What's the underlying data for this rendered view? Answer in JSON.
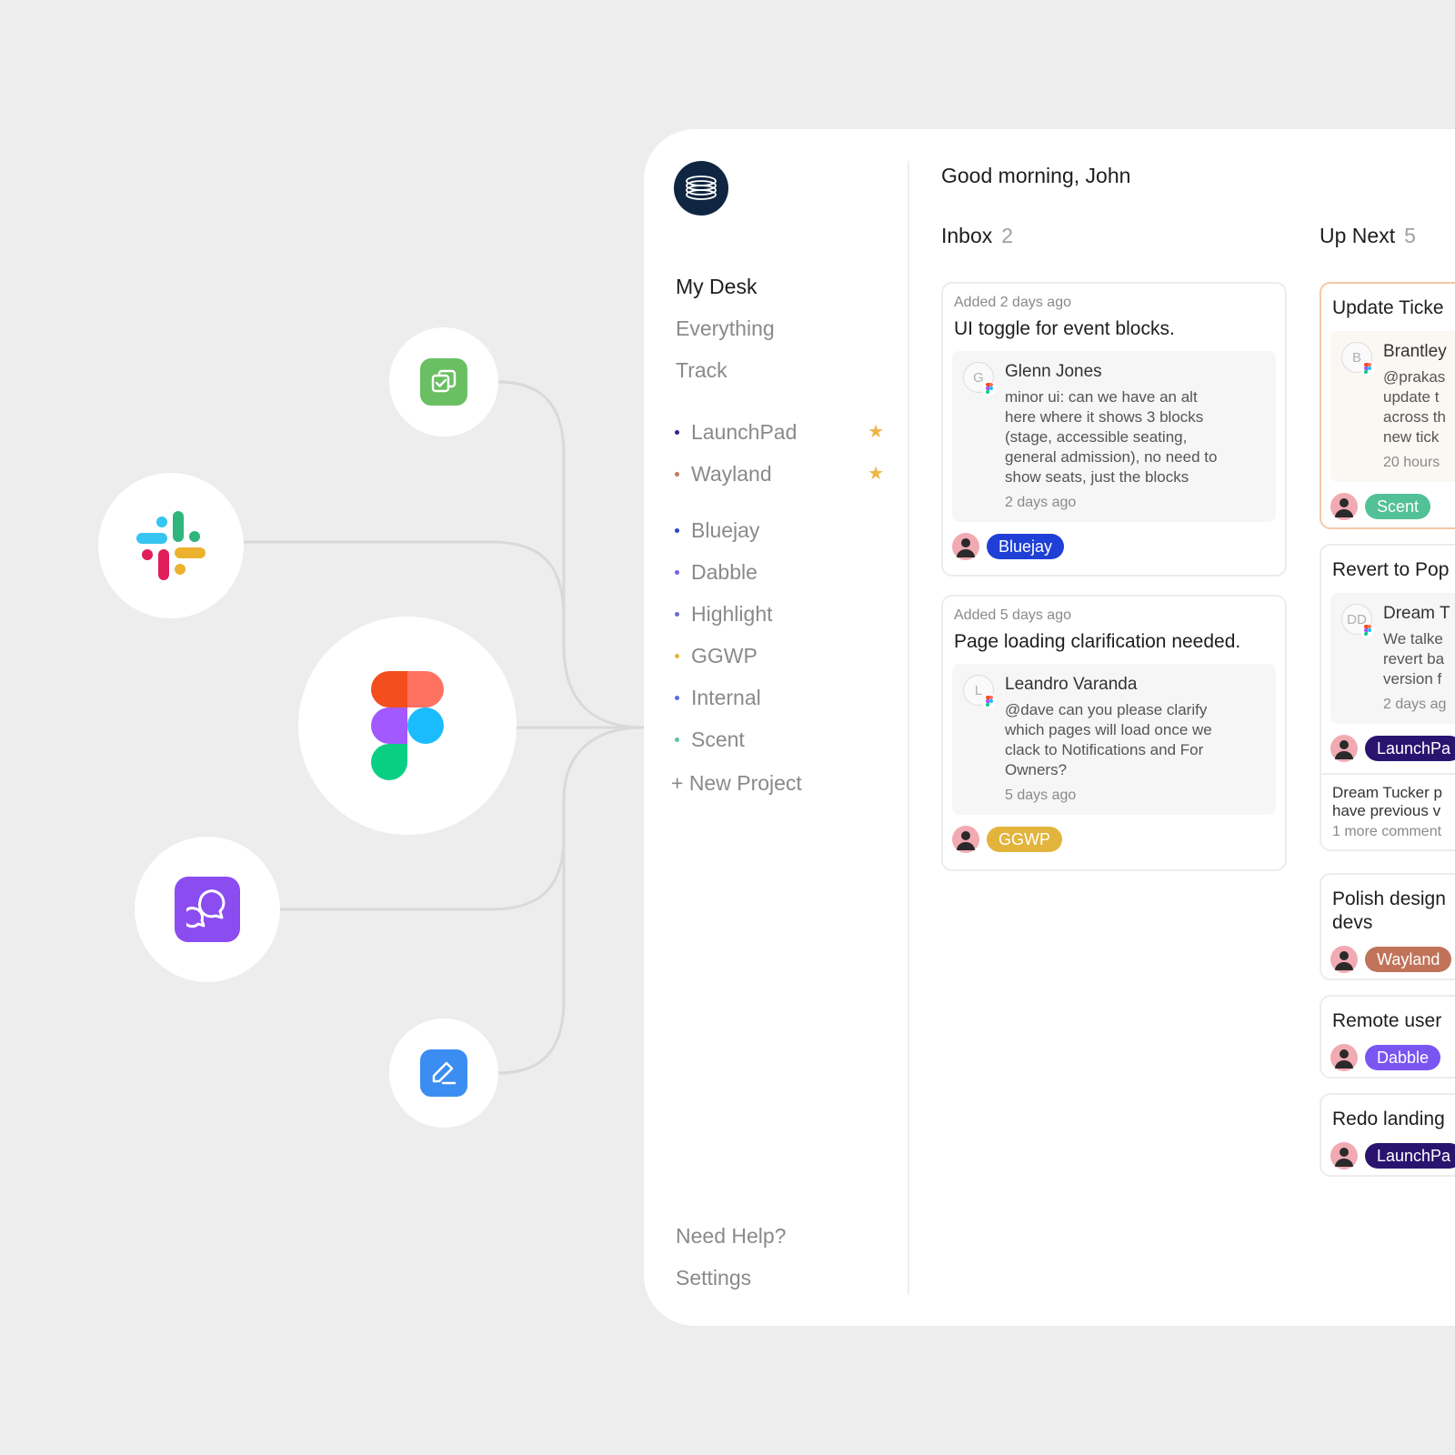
{
  "greeting": "Good morning, John",
  "nav": {
    "main": [
      "My Desk",
      "Everything",
      "Track"
    ],
    "favorites": [
      {
        "label": "LaunchPad",
        "color": "#3a1f8f"
      },
      {
        "label": "Wayland",
        "color": "#c07a5a"
      }
    ],
    "projects": [
      {
        "label": "Bluejay",
        "color": "#2546d6"
      },
      {
        "label": "Dabble",
        "color": "#7d5cf0"
      },
      {
        "label": "Highlight",
        "color": "#6b6ad8"
      },
      {
        "label": "GGWP",
        "color": "#e2b43c"
      },
      {
        "label": "Internal",
        "color": "#5b6cf0"
      },
      {
        "label": "Scent",
        "color": "#5cc3a0"
      }
    ],
    "new_project": "+ New Project",
    "bottom": [
      "Need Help?",
      "Settings"
    ]
  },
  "inbox": {
    "label": "Inbox",
    "count": "2",
    "cards": [
      {
        "added": "Added 2 days ago",
        "title": "UI toggle for event blocks.",
        "comment": {
          "initial": "G",
          "name": "Glenn Jones",
          "body": "minor ui: can we have an alt\nhere where it shows 3 blocks\n(stage, accessible seating,\ngeneral admission), no need to\nshow seats, just the blocks",
          "time": "2 days ago"
        },
        "tag": "Bluejay",
        "tag_color": "#1f3fd6"
      },
      {
        "added": "Added 5 days ago",
        "title": "Page loading clarification needed.",
        "comment": {
          "initial": "L",
          "name": "Leandro Varanda",
          "body": "@dave can you please clarify\nwhich pages will load once we\nclack to Notifications and For\nOwners?",
          "time": "5 days ago"
        },
        "tag": "GGWP",
        "tag_color": "#e2b43c"
      }
    ]
  },
  "up_next": {
    "label": "Up Next",
    "count": "5",
    "cards": [
      {
        "title": "Update Ticke",
        "comment": {
          "initial": "B",
          "name": "Brantley",
          "body": "@prakas\nupdate t\nacross th\nnew tick",
          "time": "20 hours"
        },
        "tag": "Scent",
        "tag_color": "#52c197"
      },
      {
        "title": "Revert to Pop",
        "comment": {
          "initial": "DD",
          "name": "Dream T",
          "body": "We talke\nrevert ba\nversion f",
          "time": "2 days ag"
        },
        "tag": "LaunchPa",
        "tag_color": "#2b1470",
        "extra_name": "Dream Tucker p",
        "extra_body": "have previous v",
        "extra_more": "1 more comment"
      },
      {
        "title": "Polish design\ndevs",
        "tag": "Wayland",
        "tag_color": "#c07358"
      },
      {
        "title": "Remote user",
        "tag": "Dabble",
        "tag_color": "#7a55f2"
      },
      {
        "title": "Redo landing",
        "tag": "LaunchPa",
        "tag_color": "#2b1470"
      }
    ]
  },
  "integrations": [
    "task-app",
    "slack",
    "figma",
    "chat-app",
    "notes-app"
  ]
}
